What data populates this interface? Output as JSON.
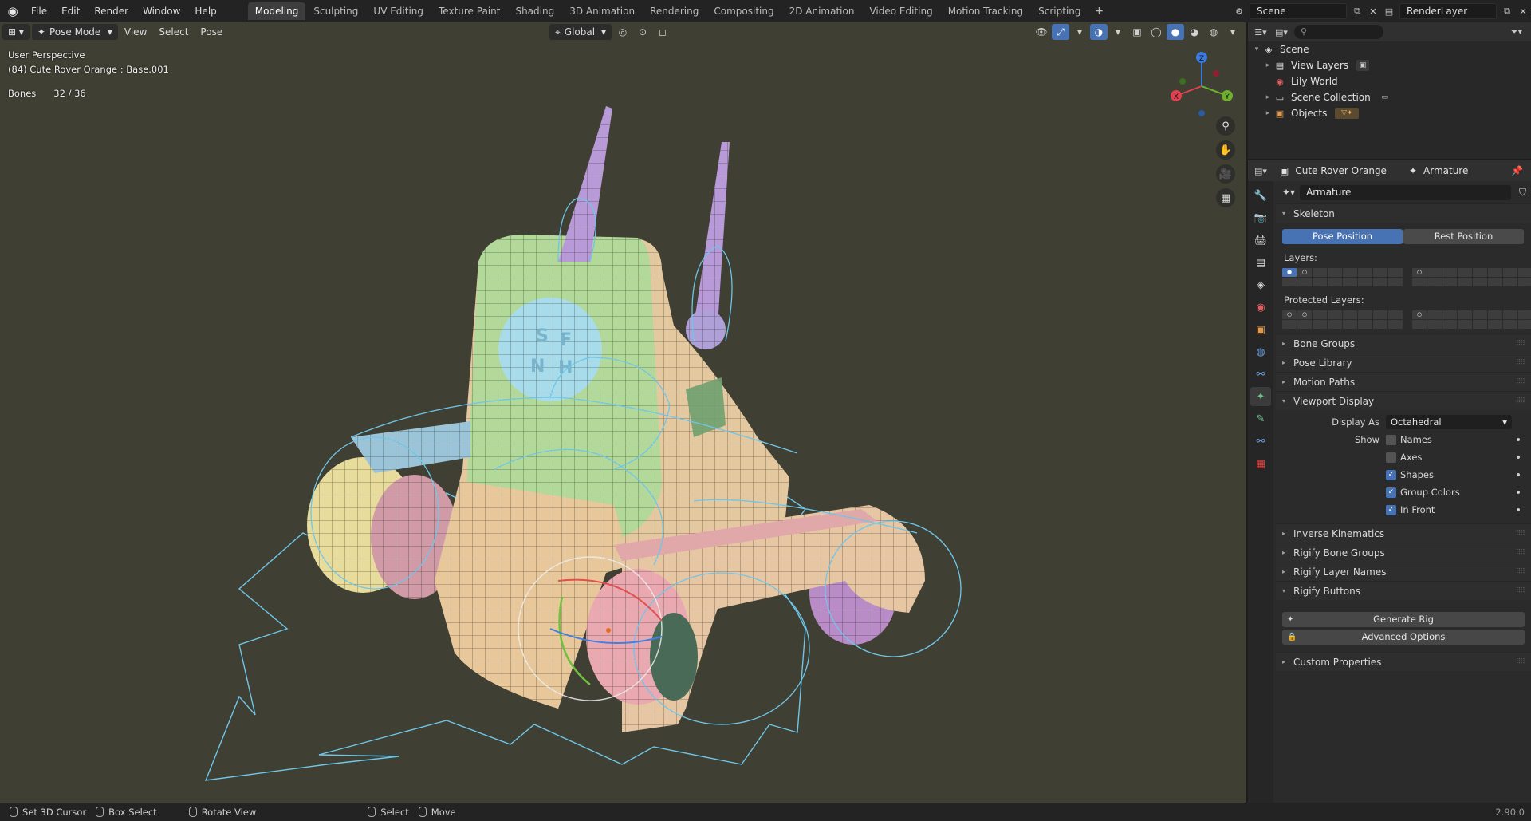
{
  "menu": [
    "File",
    "Edit",
    "Render",
    "Window",
    "Help"
  ],
  "workspaces": [
    "Modeling",
    "Sculpting",
    "UV Editing",
    "Texture Paint",
    "Shading",
    "3D Animation",
    "Rendering",
    "Compositing",
    "2D Animation",
    "Video Editing",
    "Motion Tracking",
    "Scripting"
  ],
  "active_workspace": "Modeling",
  "scene_name": "Scene",
  "view_layer_name": "RenderLayer",
  "viewport": {
    "mode": "Pose Mode",
    "menus": [
      "View",
      "Select",
      "Pose"
    ],
    "orientation": "Global",
    "view_name": "User Perspective",
    "object_info": "(84) Cute Rover Orange : Base.001",
    "stat_label": "Bones",
    "stat_value": "32 / 36",
    "decal_letters": [
      "S",
      "F",
      "N",
      "H"
    ]
  },
  "gizmo": {
    "x": "X",
    "y": "Y",
    "z": "Z"
  },
  "outliner": {
    "search_placeholder": "",
    "rows": [
      {
        "label": "Scene",
        "icon": "scene-icon"
      },
      {
        "label": "View Layers",
        "icon": "view-layers-icon"
      },
      {
        "label": "Lily World",
        "icon": "world-icon"
      },
      {
        "label": "Scene Collection",
        "icon": "collection-icon"
      },
      {
        "label": "Objects",
        "icon": "objects-icon"
      }
    ]
  },
  "properties": {
    "object_name": "Cute Rover Orange",
    "data_type": "Armature",
    "data_name": "Armature",
    "skeleton": {
      "title": "Skeleton",
      "pose_position": "Pose Position",
      "rest_position": "Rest Position",
      "layers_label": "Layers:",
      "protected_label": "Protected Layers:"
    },
    "collapsed_panels_top": [
      "Bone Groups",
      "Pose Library",
      "Motion Paths"
    ],
    "viewport_display": {
      "title": "Viewport Display",
      "display_as_label": "Display As",
      "display_as_value": "Octahedral",
      "show_label": "Show",
      "options": [
        {
          "label": "Names",
          "checked": false
        },
        {
          "label": "Axes",
          "checked": false
        },
        {
          "label": "Shapes",
          "checked": true
        },
        {
          "label": "Group Colors",
          "checked": true
        },
        {
          "label": "In Front",
          "checked": true
        }
      ]
    },
    "collapsed_panels_mid": [
      "Inverse Kinematics",
      "Rigify Bone Groups",
      "Rigify Layer Names"
    ],
    "rigify_buttons": {
      "title": "Rigify Buttons",
      "generate": "Generate Rig",
      "advanced": "Advanced Options"
    },
    "custom_properties": "Custom Properties"
  },
  "statusbar": {
    "items": [
      "Set 3D Cursor",
      "Box Select",
      "Rotate View",
      "Select",
      "Move"
    ],
    "version": "2.90.0"
  },
  "colors": {
    "accent": "#4772b3",
    "viewport_bg": "#3f3f33",
    "bone_wire": "#6fc6e8"
  }
}
